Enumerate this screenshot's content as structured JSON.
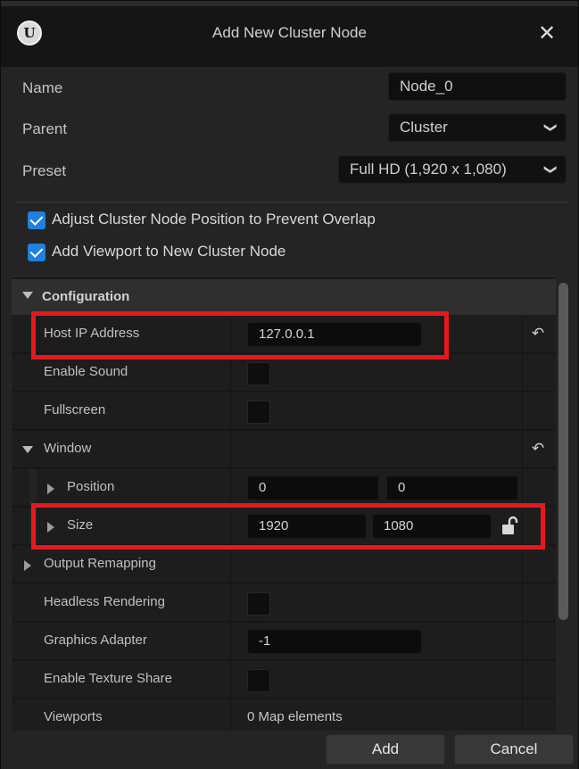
{
  "dialog": {
    "title": "Add New Cluster Node",
    "close_icon": "close-icon"
  },
  "form": {
    "name_label": "Name",
    "name_value": "Node_0",
    "parent_label": "Parent",
    "parent_value": "Cluster",
    "preset_label": "Preset",
    "preset_value": "Full HD (1,920 x 1,080)",
    "adjust_label": "Adjust Cluster Node Position to Prevent Overlap",
    "adjust_checked": true,
    "add_viewport_label": "Add Viewport to New Cluster Node",
    "add_viewport_checked": true
  },
  "details": {
    "configuration_label": "Configuration",
    "host_ip_label": "Host IP Address",
    "host_ip_value": "127.0.0.1",
    "enable_sound_label": "Enable Sound",
    "fullscreen_label": "Fullscreen",
    "window_label": "Window",
    "position_label": "Position",
    "position_x": "0",
    "position_y": "0",
    "size_label": "Size",
    "size_w": "1920",
    "size_h": "1080",
    "output_remapping_label": "Output Remapping",
    "headless_rendering_label": "Headless Rendering",
    "graphics_adapter_label": "Graphics Adapter",
    "graphics_adapter_value": "-1",
    "enable_texture_share_label": "Enable Texture Share",
    "viewports_label": "Viewports",
    "viewports_value": "0 Map elements"
  },
  "footer": {
    "add_label": "Add",
    "cancel_label": "Cancel"
  },
  "colors": {
    "accent": "#1f80e0",
    "highlight": "#e8171d"
  }
}
